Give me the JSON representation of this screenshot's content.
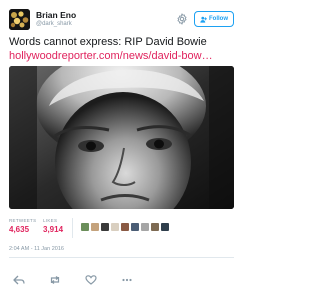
{
  "user": {
    "display_name": "Brian Eno",
    "handle": "@dark_shark",
    "avatar_icon": "avatar-image"
  },
  "header": {
    "settings_icon": "gear-icon",
    "follow_label": "Follow",
    "follow_icon": "add-user-icon"
  },
  "tweet": {
    "text": "Words cannot express: RIP David Bowie",
    "link": "hollywoodreporter.com/news/david-bow…"
  },
  "stats": {
    "retweets_label": "RETWEETS",
    "retweets_value": "4,635",
    "likes_label": "LIKES",
    "likes_value": "3,914"
  },
  "timestamp": "2:04 AM - 11 Jan 2016",
  "actions": [
    "reply-icon",
    "retweet-icon",
    "like-icon",
    "more-icon"
  ],
  "colors": {
    "accent": "#1da1f2",
    "link": "#e0245e",
    "muted": "#8899a6"
  }
}
